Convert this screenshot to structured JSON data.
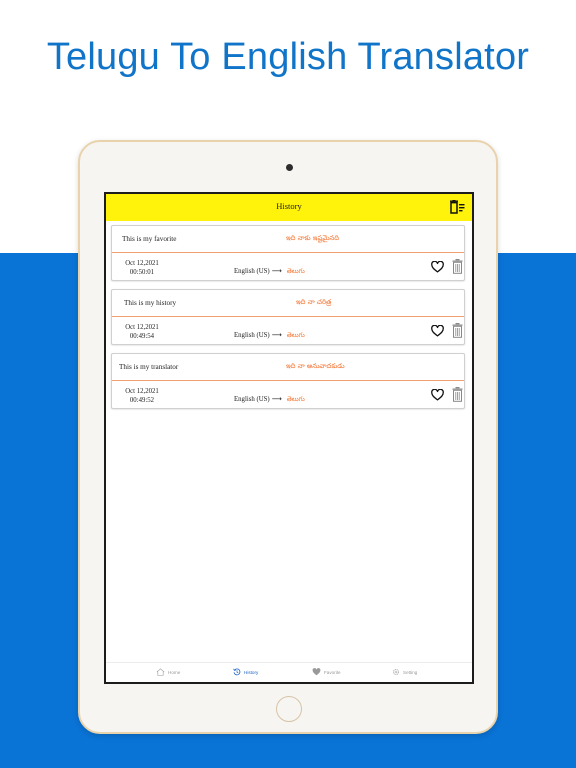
{
  "headline": "Telugu To English Translator",
  "screen": {
    "title": "History",
    "entries": [
      {
        "source": "This is my favorite",
        "target": "ఇది నాకు ఇష్టమైనది",
        "date": "Oct 12,2021",
        "time": "00:50:01",
        "from_lang": "English (US)",
        "arrow": "⟶",
        "to_lang": "తెలుగు"
      },
      {
        "source": "This is my history",
        "target": "ఇది నా చరిత్ర",
        "date": "Oct 12,2021",
        "time": "00:49:54",
        "from_lang": "English (US)",
        "arrow": "⟶",
        "to_lang": "తెలుగు"
      },
      {
        "source": "This is my translator",
        "target": "ఇది నా అనువాదకుడు",
        "date": "Oct 12,2021",
        "time": "00:49:52",
        "from_lang": "English (US)",
        "arrow": "⟶",
        "to_lang": "తెలుగు"
      }
    ],
    "nav": [
      {
        "label": "Home",
        "icon": "home-icon",
        "active": false
      },
      {
        "label": "History",
        "icon": "history-icon",
        "active": true
      },
      {
        "label": "Favorite",
        "icon": "heart-icon",
        "active": false
      },
      {
        "label": "Setting",
        "icon": "gear-icon",
        "active": false
      }
    ]
  },
  "colors": {
    "headline": "#1074c9",
    "band": "#0a73d6",
    "topbar": "#fff30b",
    "translation_text": "#f2702b",
    "nav_active": "#1e63c4"
  }
}
